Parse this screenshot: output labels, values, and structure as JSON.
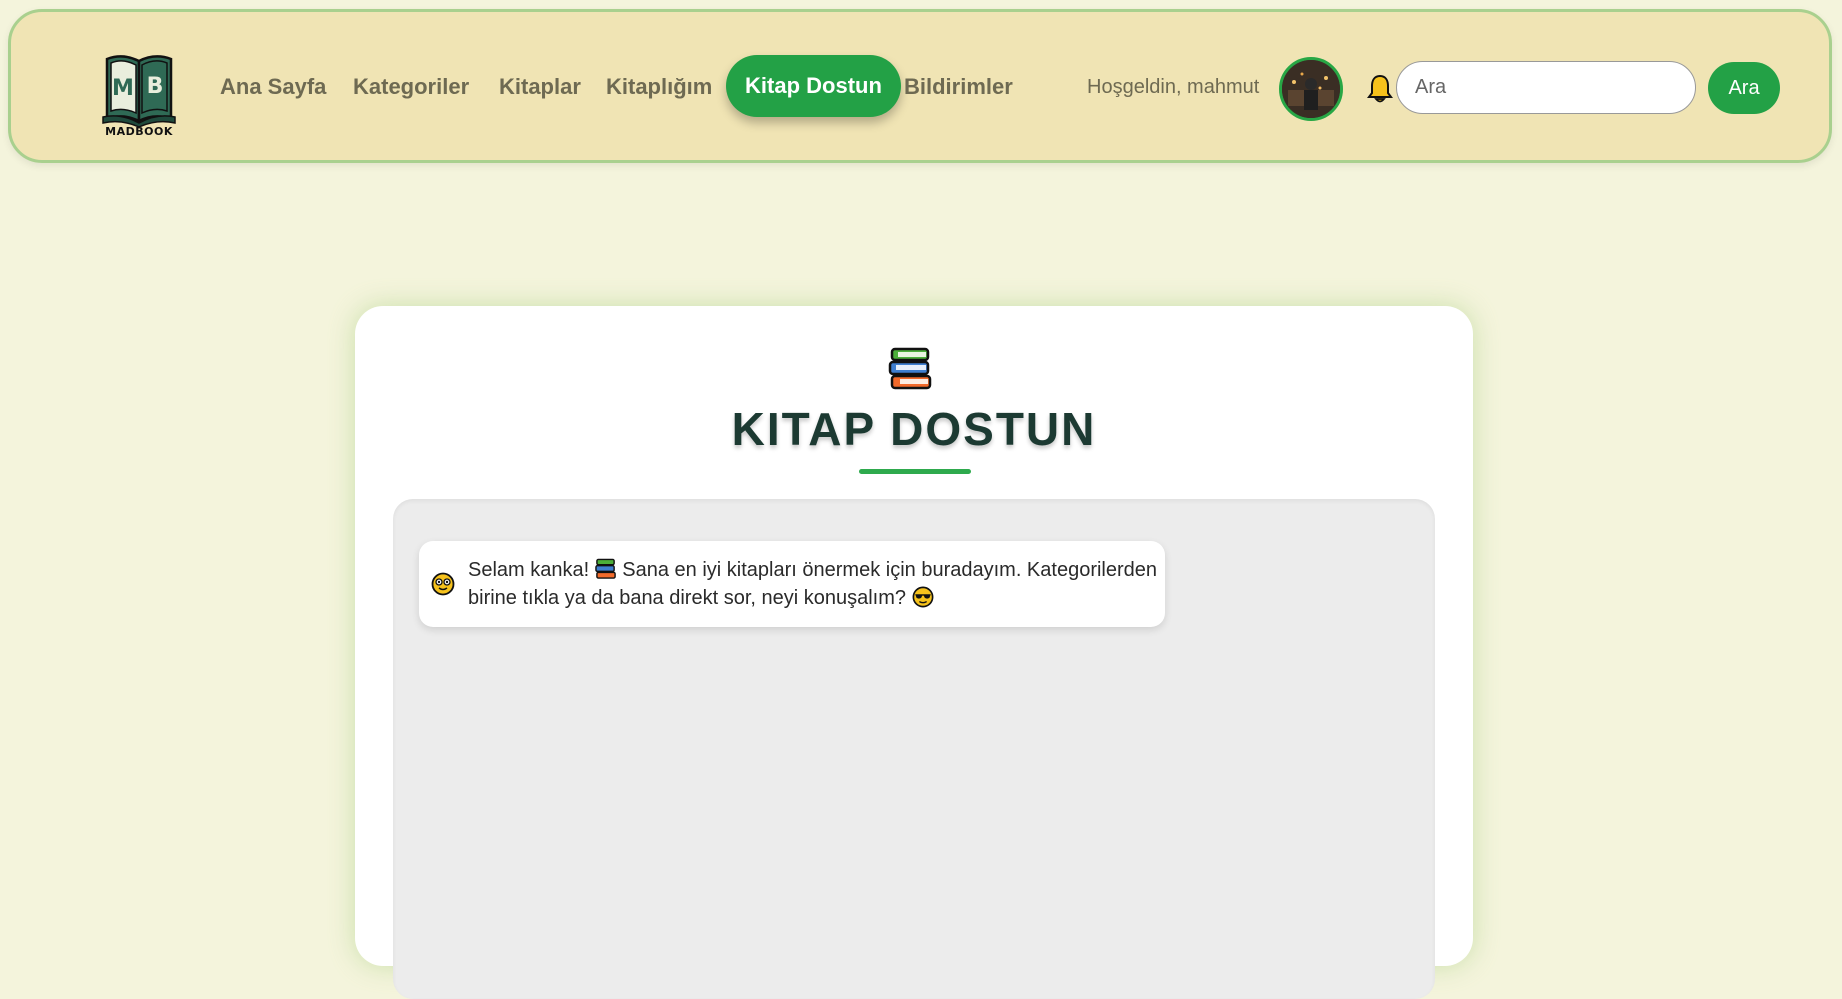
{
  "brand": {
    "logo_text": "MADBOOK",
    "logo_letters": "MB"
  },
  "nav": {
    "items": [
      {
        "label": "Ana Sayfa"
      },
      {
        "label": "Kategoriler"
      },
      {
        "label": "Kitaplar"
      },
      {
        "label": "Kitaplığım"
      },
      {
        "label": "Kitap Dostun",
        "active": true
      },
      {
        "label": "Bildirimler"
      }
    ]
  },
  "user": {
    "welcome": "Hoşgeldin, mahmut"
  },
  "search": {
    "placeholder": "Ara",
    "button_label": "Ara"
  },
  "card": {
    "title": "KITAP DOSTUN",
    "message": {
      "part1": "Selam kanka! ",
      "part2": " Sana en iyi kitapları önermek için buradayım. Kategorilerden birine tıkla ya da bana direkt sor, neyi konuşalım? "
    }
  },
  "colors": {
    "accent": "#23a146",
    "navbar_bg": "#f0e4b4",
    "page_bg": "#f4f4dc",
    "title": "#1c3a32"
  },
  "icons": [
    "book-logo-icon",
    "bell-icon",
    "books-icon",
    "bot-face-icon",
    "sunglasses-emoji-icon"
  ]
}
